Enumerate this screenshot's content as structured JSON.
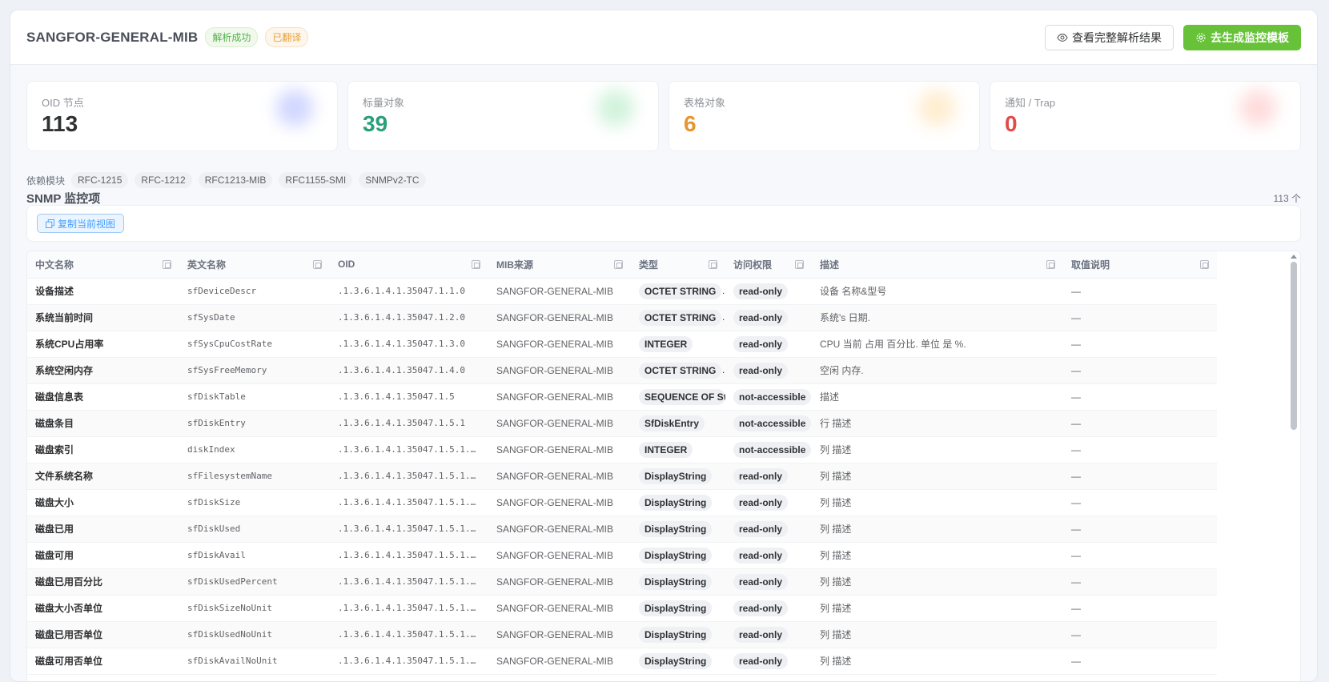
{
  "header": {
    "title": "SANGFOR-GENERAL-MIB",
    "tag_parsed": "解析成功",
    "tag_translated": "已翻译",
    "btn_view_full": "查看完整解析结果",
    "btn_generate": "去生成监控模板"
  },
  "stats": [
    {
      "label": "OID 节点",
      "value": "113",
      "color": "#303133",
      "blob": "#7b8cff"
    },
    {
      "label": "标量对象",
      "value": "39",
      "color": "#2aa07a",
      "blob": "#7ddc9a"
    },
    {
      "label": "表格对象",
      "value": "6",
      "color": "#e6962e",
      "blob": "#ffcc7a"
    },
    {
      "label": "通知 / Trap",
      "value": "0",
      "color": "#e04b4b",
      "blob": "#ff9a9a"
    }
  ],
  "dependencies": {
    "label": "依赖模块",
    "items": [
      "RFC-1215",
      "RFC-1212",
      "RFC1213-MIB",
      "RFC1155-SMI",
      "SNMPv2-TC"
    ]
  },
  "section": {
    "title": "SNMP 监控项",
    "count": "113 个",
    "copy_view": "复制当前视图"
  },
  "table": {
    "columns": [
      "中文名称",
      "英文名称",
      "OID",
      "MIB来源",
      "类型",
      "访问权限",
      "描述",
      "取值说明"
    ],
    "rows": [
      [
        "设备描述",
        "sfDeviceDescr",
        ".1.3.6.1.4.1.35047.1.1.0",
        "SANGFOR-GENERAL-MIB",
        "OCTET STRING",
        "read-only",
        "设备 名称&型号",
        "—"
      ],
      [
        "系统当前时间",
        "sfSysDate",
        ".1.3.6.1.4.1.35047.1.2.0",
        "SANGFOR-GENERAL-MIB",
        "OCTET STRING",
        "read-only",
        "系统's 日期.",
        "—"
      ],
      [
        "系统CPU占用率",
        "sfSysCpuCostRate",
        ".1.3.6.1.4.1.35047.1.3.0",
        "SANGFOR-GENERAL-MIB",
        "INTEGER",
        "read-only",
        "CPU 当前 占用 百分比. 单位 是 %.",
        "—"
      ],
      [
        "系统空闲内存",
        "sfSysFreeMemory",
        ".1.3.6.1.4.1.35047.1.4.0",
        "SANGFOR-GENERAL-MIB",
        "OCTET STRING",
        "read-only",
        "空闲 内存.",
        "—"
      ],
      [
        "磁盘信息表",
        "sfDiskTable",
        ".1.3.6.1.4.1.35047.1.5",
        "SANGFOR-GENERAL-MIB",
        "SEQUENCE OF Sf",
        "not-accessible",
        "描述",
        "—"
      ],
      [
        "磁盘条目",
        "sfDiskEntry",
        ".1.3.6.1.4.1.35047.1.5.1",
        "SANGFOR-GENERAL-MIB",
        "SfDiskEntry",
        "not-accessible",
        "行 描述",
        "—"
      ],
      [
        "磁盘索引",
        "diskIndex",
        ".1.3.6.1.4.1.35047.1.5.1.1...",
        "SANGFOR-GENERAL-MIB",
        "INTEGER",
        "not-accessible",
        "列 描述",
        "—"
      ],
      [
        "文件系统名称",
        "sfFilesystemName",
        ".1.3.6.1.4.1.35047.1.5.1.2...",
        "SANGFOR-GENERAL-MIB",
        "DisplayString",
        "read-only",
        "列 描述",
        "—"
      ],
      [
        "磁盘大小",
        "sfDiskSize",
        ".1.3.6.1.4.1.35047.1.5.1.3...",
        "SANGFOR-GENERAL-MIB",
        "DisplayString",
        "read-only",
        "列 描述",
        "—"
      ],
      [
        "磁盘已用",
        "sfDiskUsed",
        ".1.3.6.1.4.1.35047.1.5.1.4...",
        "SANGFOR-GENERAL-MIB",
        "DisplayString",
        "read-only",
        "列 描述",
        "—"
      ],
      [
        "磁盘可用",
        "sfDiskAvail",
        ".1.3.6.1.4.1.35047.1.5.1.5...",
        "SANGFOR-GENERAL-MIB",
        "DisplayString",
        "read-only",
        "列 描述",
        "—"
      ],
      [
        "磁盘已用百分比",
        "sfDiskUsedPercent",
        ".1.3.6.1.4.1.35047.1.5.1.6...",
        "SANGFOR-GENERAL-MIB",
        "DisplayString",
        "read-only",
        "列 描述",
        "—"
      ],
      [
        "磁盘大小否单位",
        "sfDiskSizeNoUnit",
        ".1.3.6.1.4.1.35047.1.5.1.7...",
        "SANGFOR-GENERAL-MIB",
        "DisplayString",
        "read-only",
        "列 描述",
        "—"
      ],
      [
        "磁盘已用否单位",
        "sfDiskUsedNoUnit",
        ".1.3.6.1.4.1.35047.1.5.1.8...",
        "SANGFOR-GENERAL-MIB",
        "DisplayString",
        "read-only",
        "列 描述",
        "—"
      ],
      [
        "磁盘可用否单位",
        "sfDiskAvailNoUnit",
        ".1.3.6.1.4.1.35047.1.5.1.9...",
        "SANGFOR-GENERAL-MIB",
        "DisplayString",
        "read-only",
        "列 描述",
        "—"
      ]
    ]
  }
}
